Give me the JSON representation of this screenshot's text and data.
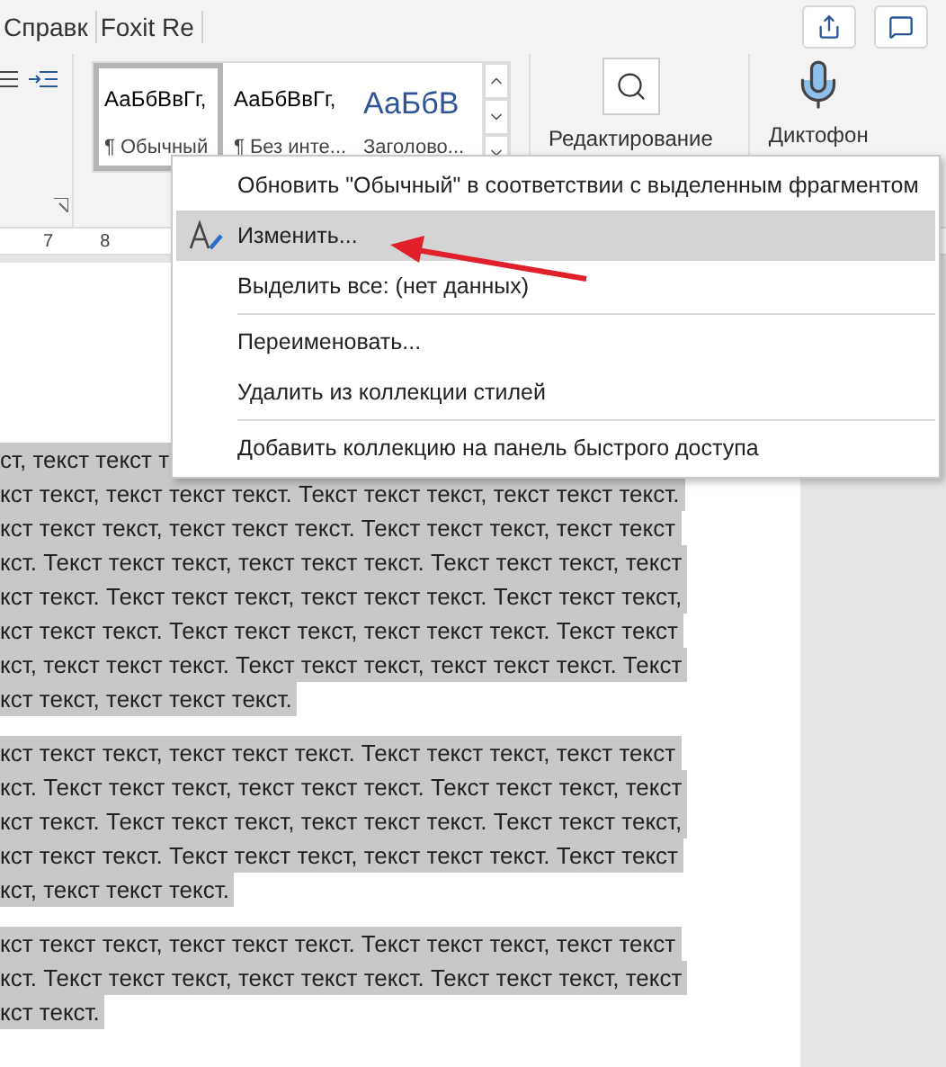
{
  "tabs": [
    {
      "label": "Справк"
    },
    {
      "label": "Foxit Re"
    }
  ],
  "ribbon": {
    "styles": [
      {
        "preview": "АаБбВвГг,",
        "name": "¶ Обычный",
        "kind": "normal",
        "selected": true
      },
      {
        "preview": "АаБбВвГг,",
        "name": "¶ Без инте...",
        "kind": "normal",
        "selected": false
      },
      {
        "preview": "АаБбВ",
        "name": "Заголово...",
        "kind": "heading",
        "selected": false
      }
    ],
    "editing": {
      "label": "Редактирование"
    },
    "dictate": {
      "label": "Диктофон"
    }
  },
  "ruler": [
    "7",
    "8"
  ],
  "context_menu": [
    {
      "kind": "item",
      "label": "Обновить \"Обычный\" в соответствии с выделенным фрагментом",
      "icon": false,
      "selected": false
    },
    {
      "kind": "item",
      "label": "Изменить...",
      "icon": true,
      "selected": true
    },
    {
      "kind": "item",
      "label": "Выделить все: (нет данных)",
      "icon": false,
      "selected": false
    },
    {
      "kind": "separator"
    },
    {
      "kind": "item",
      "label": "Переименовать...",
      "icon": false,
      "selected": false
    },
    {
      "kind": "item",
      "label": "Удалить из коллекции стилей",
      "icon": false,
      "selected": false
    },
    {
      "kind": "separator"
    },
    {
      "kind": "item",
      "label": "Добавить коллекцию на панель быстрого доступа",
      "icon": false,
      "selected": false
    }
  ],
  "document": {
    "paragraphs": [
      [
        "ст, текст текст т",
        "кст текст, текст текст текст. Текст текст текст, текст текст текст.",
        "кст текст текст, текст текст текст. Текст текст текст, текст текст",
        "кст. Текст текст текст, текст текст текст. Текст текст текст, текст",
        "кст текст. Текст текст текст, текст текст текст. Текст текст текст,",
        "кст текст текст. Текст текст текст, текст текст текст. Текст текст",
        "кст, текст текст текст. Текст текст текст, текст текст текст. Текст",
        "кст текст, текст текст текст."
      ],
      [
        "кст текст текст, текст текст текст. Текст текст текст, текст текст",
        "кст. Текст текст текст, текст текст текст. Текст текст текст, текст",
        "кст текст. Текст текст текст, текст текст текст. Текст текст текст,",
        "кст текст текст. Текст текст текст, текст текст текст. Текст текст",
        "кст, текст текст текст."
      ],
      [
        "кст текст текст, текст текст текст. Текст текст текст, текст текст",
        "кст. Текст текст текст, текст текст текст. Текст текст текст, текст",
        "кст текст."
      ]
    ]
  }
}
